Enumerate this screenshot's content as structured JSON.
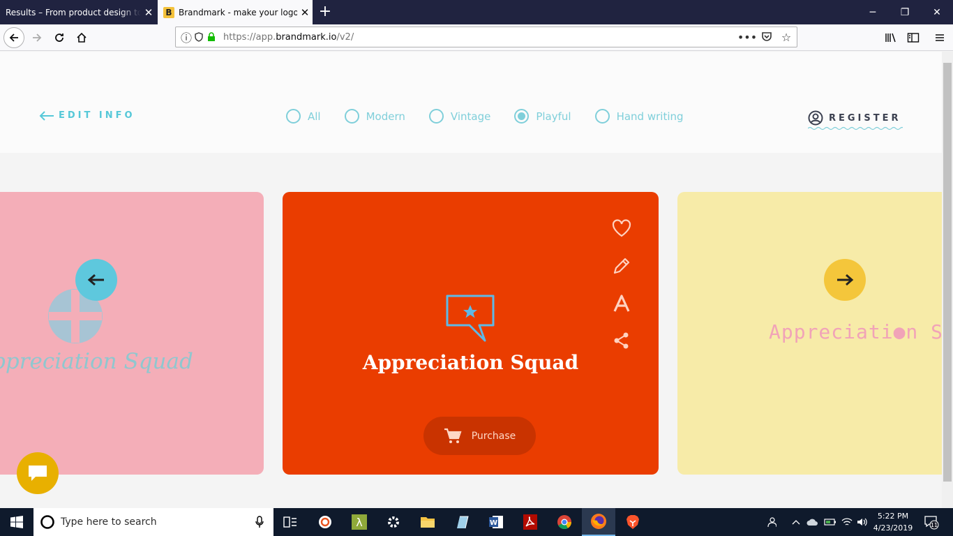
{
  "browser": {
    "tabs": [
      {
        "title": "Results – From product design to d",
        "active": false
      },
      {
        "title": "Brandmark - make your logo in",
        "active": true,
        "favicon": "B"
      }
    ],
    "url_prefix": "https://app.",
    "url_domain": "brandmark.io",
    "url_path": "/v2/"
  },
  "header": {
    "edit_info": "EDIT INFO",
    "register": "REGISTER",
    "filters": [
      {
        "label": "All",
        "checked": false
      },
      {
        "label": "Modern",
        "checked": false
      },
      {
        "label": "Vintage",
        "checked": false
      },
      {
        "label": "Playful",
        "checked": true
      },
      {
        "label": "Hand writing",
        "checked": false
      }
    ]
  },
  "cards": {
    "left": {
      "name": "ppreciation Squad",
      "bg": "#f4aeb8",
      "text_color": "#8fc7cf"
    },
    "center": {
      "name": "Appreciation Squad",
      "bg": "#ea3d00",
      "purchase_label": "Purchase"
    },
    "right": {
      "name": "Appreciati●n Squ",
      "bg": "#f7eba8",
      "text_color": "#f1a3b8"
    }
  },
  "card_actions": [
    "heart-icon",
    "pencil-icon",
    "font-icon",
    "share-icon"
  ],
  "colors": {
    "accent": "#56c8d8",
    "prev_btn": "#5ec8dd",
    "next_btn": "#f4c63b",
    "chat": "#e8b000"
  },
  "taskbar": {
    "search_placeholder": "Type here to search",
    "time": "5:22 PM",
    "date": "4/23/2019",
    "notifications": "11"
  }
}
